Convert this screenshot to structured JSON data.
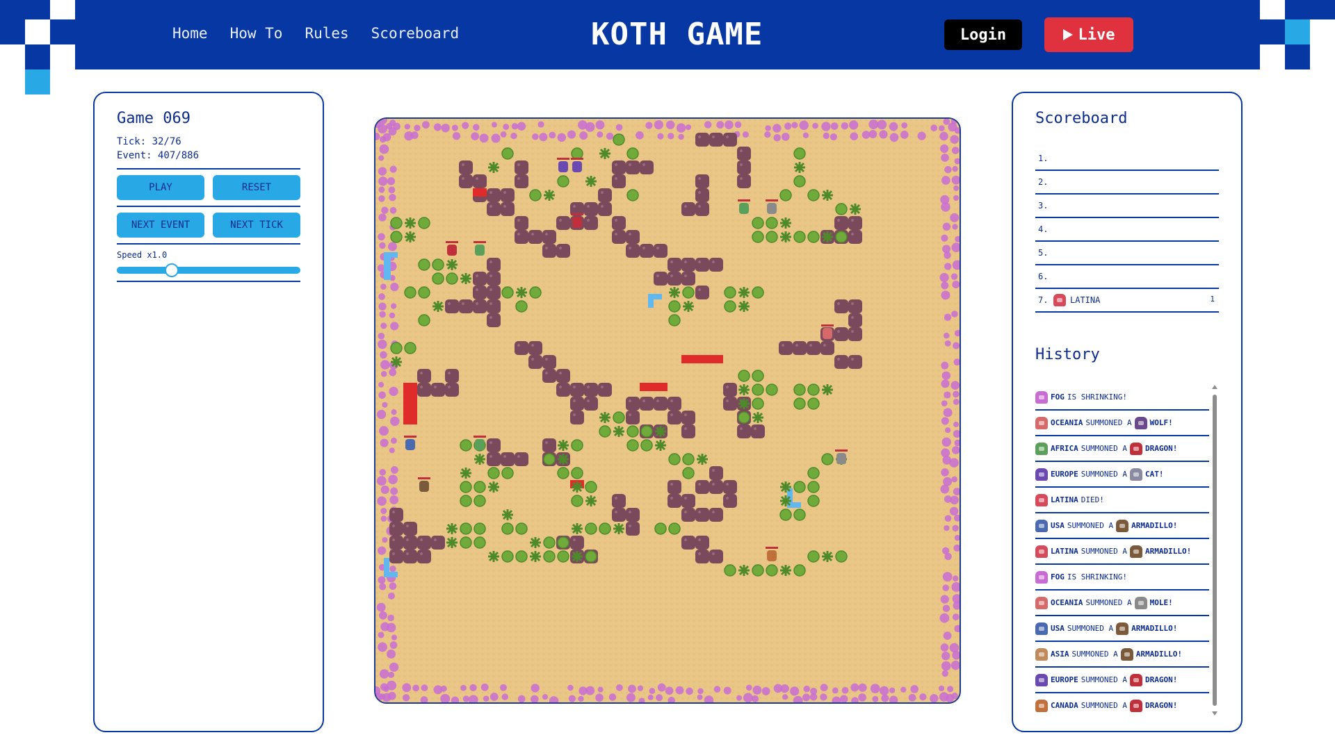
{
  "header": {
    "nav": [
      "Home",
      "How To",
      "Rules",
      "Scoreboard"
    ],
    "logo": "KOTH GAME",
    "login_label": "Login",
    "live_label": "Live",
    "colors": {
      "bar": "#0737a3",
      "pixel_light": "#29a8e6",
      "live": "#e0313f"
    }
  },
  "controls": {
    "game_title": "Game 069",
    "tick": "Tick: 32/76",
    "event": "Event: 407/886",
    "play_label": "PLAY",
    "reset_label": "RESET",
    "next_event_label": "NEXT EVENT",
    "next_tick_label": "NEXT TICK",
    "speed_label": "Speed x1.0",
    "speed_fraction": 0.3
  },
  "map": {
    "terrain_colors": {
      "sand": "#e9c686",
      "rock": "#7a4a5c",
      "fog": "#c86cd3",
      "tree": "#6faa3a",
      "lava": "#e02b2b",
      "water": "#61b8f0"
    }
  },
  "scoreboard": {
    "title": "Scoreboard",
    "rows": [
      {
        "rank": "1.",
        "name": "",
        "score": ""
      },
      {
        "rank": "2.",
        "name": "",
        "score": ""
      },
      {
        "rank": "3.",
        "name": "",
        "score": ""
      },
      {
        "rank": "4.",
        "name": "",
        "score": ""
      },
      {
        "rank": "5.",
        "name": "",
        "score": ""
      },
      {
        "rank": "6.",
        "name": "",
        "score": ""
      },
      {
        "rank": "7.",
        "name": "LATINA",
        "score": "1",
        "color": "#d64a5a"
      }
    ]
  },
  "history": {
    "title": "History",
    "items": [
      {
        "actor": "FOG",
        "text": "IS SHRINKING!",
        "target": "",
        "actor_color": "#c86cd3"
      },
      {
        "actor": "OCEANIA",
        "text": "SUMMONED A",
        "target": "WOLF!",
        "actor_color": "#d66a6a",
        "target_color": "#6a4a8a"
      },
      {
        "actor": "AFRICA",
        "text": "SUMMONED A",
        "target": "DRAGON!",
        "actor_color": "#5aa05a",
        "target_color": "#c0303a"
      },
      {
        "actor": "EUROPE",
        "text": "SUMMONED A",
        "target": "CAT!",
        "actor_color": "#6a4ab0",
        "target_color": "#8a8aa0"
      },
      {
        "actor": "LATINA",
        "text": "DIED!",
        "target": "",
        "actor_color": "#d64a5a"
      },
      {
        "actor": "USA",
        "text": "SUMMONED A",
        "target": "ARMADILLO!",
        "actor_color": "#4a6ab0",
        "target_color": "#7a5a3a"
      },
      {
        "actor": "LATINA",
        "text": "SUMMONED A",
        "target": "ARMADILLO!",
        "actor_color": "#d64a5a",
        "target_color": "#7a5a3a"
      },
      {
        "actor": "FOG",
        "text": "IS SHRINKING!",
        "target": "",
        "actor_color": "#c86cd3"
      },
      {
        "actor": "OCEANIA",
        "text": "SUMMONED A",
        "target": "MOLE!",
        "actor_color": "#d66a6a",
        "target_color": "#8a8a8a"
      },
      {
        "actor": "USA",
        "text": "SUMMONED A",
        "target": "ARMADILLO!",
        "actor_color": "#4a6ab0",
        "target_color": "#7a5a3a"
      },
      {
        "actor": "ASIA",
        "text": "SUMMONED A",
        "target": "ARMADILLO!",
        "actor_color": "#c08a5a",
        "target_color": "#7a5a3a"
      },
      {
        "actor": "EUROPE",
        "text": "SUMMONED A",
        "target": "DRAGON!",
        "actor_color": "#6a4ab0",
        "target_color": "#c0303a"
      },
      {
        "actor": "CANADA",
        "text": "SUMMONED A",
        "target": "DRAGON!",
        "actor_color": "#c0703a",
        "target_color": "#c0303a"
      }
    ]
  }
}
